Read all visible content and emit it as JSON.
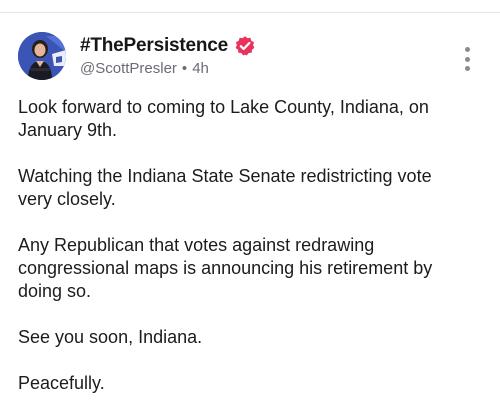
{
  "post": {
    "author": {
      "display_name": "#ThePersistence",
      "handle": "@ScottPresler",
      "verified": true,
      "verified_color": "#e8345c",
      "avatar_icon": "profile-photo-avatar"
    },
    "time_ago": "4h",
    "separator": "•",
    "menu_icon": "more-vertical-icon",
    "paragraphs": [
      "Look forward to coming to Lake County, Indiana, on\nJanuary 9th.",
      "Watching the Indiana State Senate redistricting vote\nvery closely.",
      "Any Republican that votes against redrawing\ncongressional maps is announcing his retirement by\ndoing so.",
      "See you soon, Indiana.",
      "Peacefully."
    ]
  }
}
